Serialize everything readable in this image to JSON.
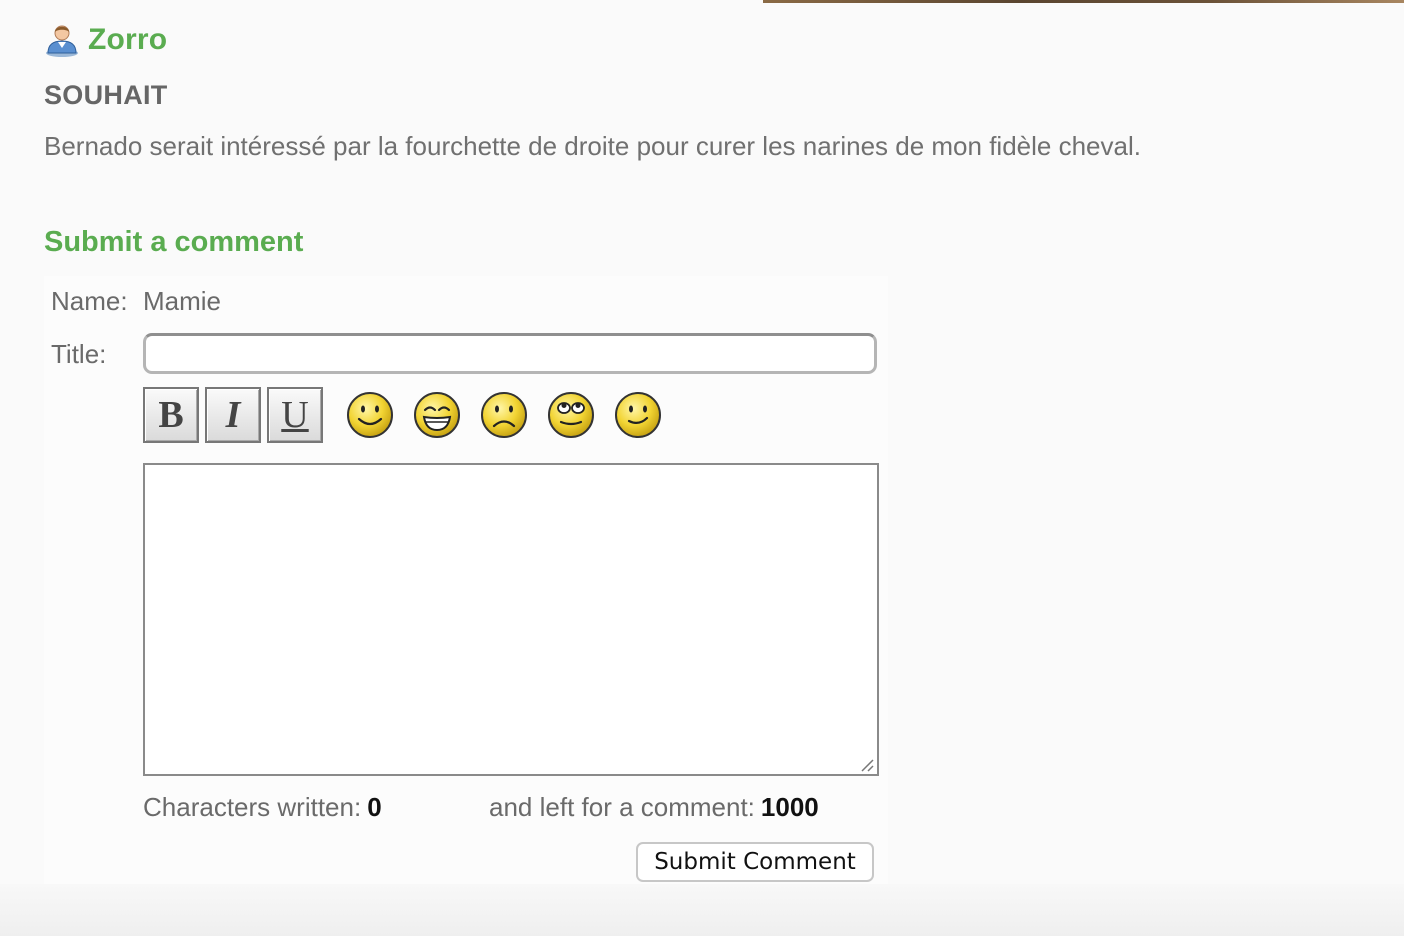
{
  "post": {
    "author": "Zorro",
    "author_icon": "user-avatar-icon",
    "label": "SOUHAIT",
    "text": "Bernado serait intéressé par la fourchette de droite pour curer les narines de mon fidèle cheval."
  },
  "comment_form": {
    "section_title": "Submit a comment",
    "name_label": "Name:",
    "name_value": "Mamie",
    "title_label": "Title:",
    "title_value": "",
    "toolbar": {
      "bold_label": "B",
      "italic_label": "I",
      "underline_label": "U",
      "smileys": [
        "smile-icon",
        "grin-icon",
        "sad-icon",
        "eye-roll-icon",
        "wink-icon"
      ]
    },
    "comment_value": "",
    "chars_written_label": "Characters written:",
    "chars_written": "0",
    "chars_left_label": "and left for a comment:",
    "chars_left": "1000",
    "submit_label": "Submit Comment"
  },
  "colors": {
    "accent_green": "#5aac50",
    "text_gray": "#6e6e6e",
    "smiley_yellow": "#f2d433"
  }
}
